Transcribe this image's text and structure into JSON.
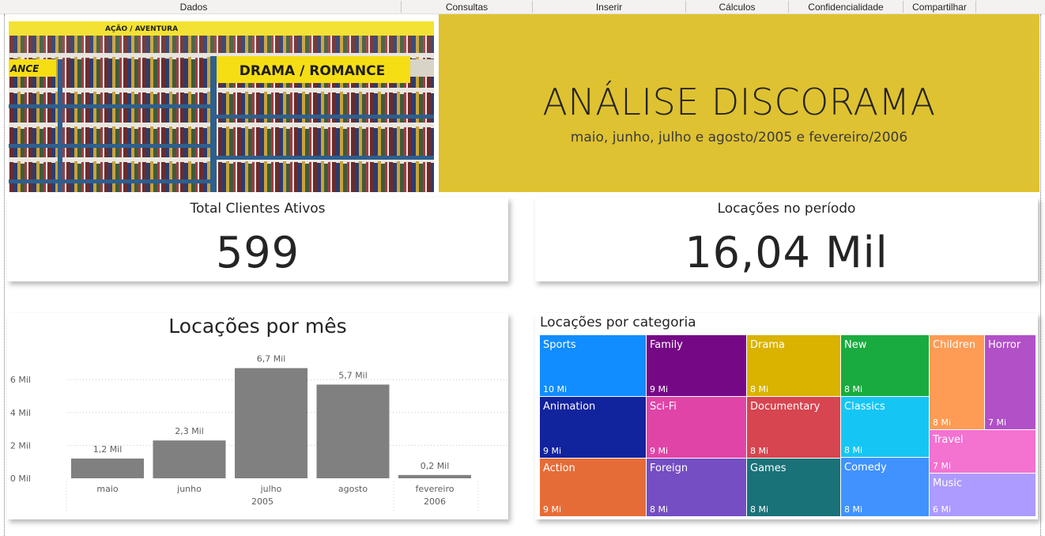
{
  "ribbon": {
    "items": [
      "Dados",
      "Consultas",
      "Inserir",
      "Cálculos",
      "Confidencialidade",
      "Compartilhar"
    ]
  },
  "hero": {
    "image_sign_1": "AÇÃO / AVENTURA",
    "image_sign_2": "DRAMA / ROMANCE",
    "image_sign_3": "ANCE",
    "title": "ANÁLISE DISCORAMA",
    "subtitle": "maio, junho, julho e agosto/2005 e fevereiro/2006",
    "banner_color": "#dfc231"
  },
  "kpi_clientes": {
    "label": "Total Clientes Ativos",
    "value": "599"
  },
  "kpi_locacoes": {
    "label": "Locações no período",
    "value": "16,04 Mil"
  },
  "chart_data": [
    {
      "type": "bar",
      "title": "Locações por mês",
      "categories": [
        "maio",
        "junho",
        "julho",
        "agosto",
        "fevereiro"
      ],
      "category_years": [
        "2005",
        "2006"
      ],
      "values": [
        1.2,
        2.3,
        6.7,
        5.7,
        0.2
      ],
      "data_labels": [
        "1,2 Mil",
        "2,3 Mil",
        "6,7 Mil",
        "5,7 Mil",
        "0,2 Mil"
      ],
      "y_ticks": [
        "0 Mil",
        "2 Mil",
        "4 Mil",
        "6 Mil"
      ],
      "y_tick_values": [
        0,
        2,
        4,
        6
      ],
      "ylim": [
        0,
        7
      ],
      "grid": true,
      "bar_color": "#808080"
    },
    {
      "type": "treemap",
      "title": "Locações por categoria",
      "items": [
        {
          "name": "Sports",
          "label": "10 Mi",
          "color": "#118dff"
        },
        {
          "name": "Family",
          "label": "9 Mi",
          "color": "#750985"
        },
        {
          "name": "Drama",
          "label": "8 Mi",
          "color": "#d9b300"
        },
        {
          "name": "New",
          "label": "8 Mi",
          "color": "#1aab40"
        },
        {
          "name": "Children",
          "label": "8 Mi",
          "color": "#fe9b54"
        },
        {
          "name": "Horror",
          "label": "7 Mi",
          "color": "#b150c7"
        },
        {
          "name": "Animation",
          "label": "9 Mi",
          "color": "#12239e"
        },
        {
          "name": "Sci-Fi",
          "label": "9 Mi",
          "color": "#e044a7"
        },
        {
          "name": "Documentary",
          "label": "8 Mi",
          "color": "#d64550"
        },
        {
          "name": "Classics",
          "label": "8 Mi",
          "color": "#15c6f4"
        },
        {
          "name": "Travel",
          "label": "7 Mi",
          "color": "#f472d0"
        },
        {
          "name": "Action",
          "label": "9 Mi",
          "color": "#e66c37"
        },
        {
          "name": "Foreign",
          "label": "8 Mi",
          "color": "#744ec2"
        },
        {
          "name": "Games",
          "label": "8 Mi",
          "color": "#197278"
        },
        {
          "name": "Comedy",
          "label": "8 Mi",
          "color": "#4092ff"
        },
        {
          "name": "Music",
          "label": "6 Mi",
          "color": "#ad9bff"
        }
      ]
    }
  ]
}
